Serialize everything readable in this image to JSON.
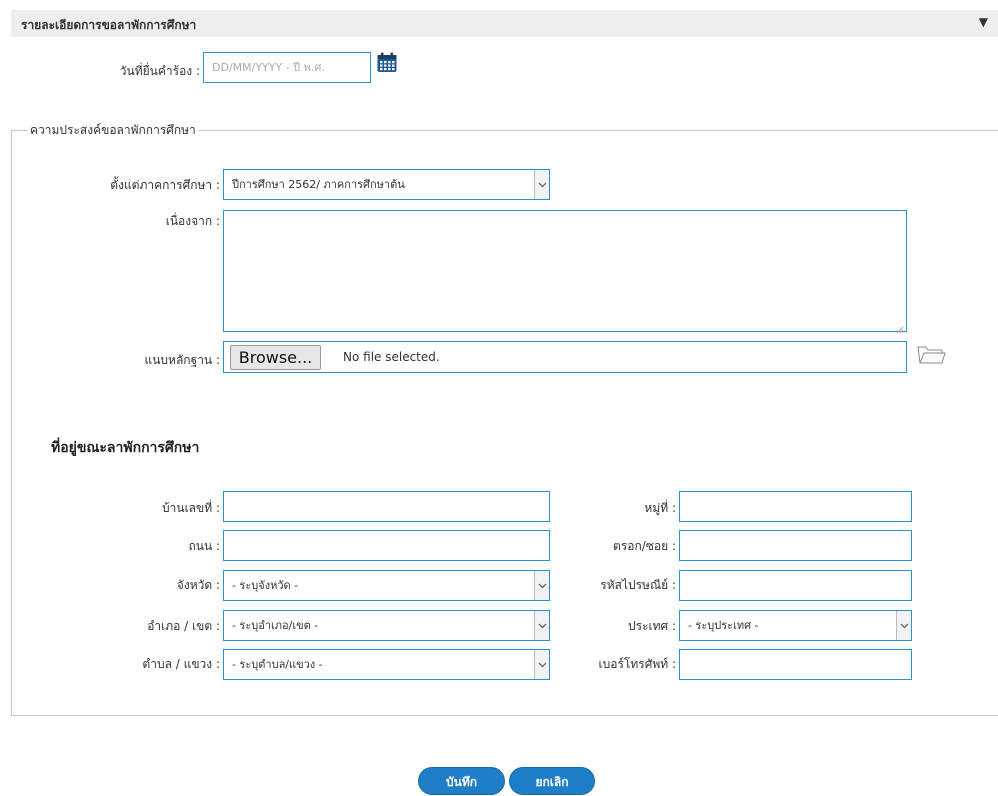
{
  "header": {
    "title": "รายละเอียดการขอลาพักการศึกษา",
    "toggle": "▼"
  },
  "request_date": {
    "label": "วันที่ยื่นคำร้อง :",
    "placeholder": "DD/MM/YYYY - ปี พ.ศ."
  },
  "purpose": {
    "legend": "ความประสงค์ขอลาพักการศึกษา",
    "term_label": "ตั้งแต่ภาคการศึกษา :",
    "term_value": "ปีการศึกษา 2562/ ภาคการศึกษาต้น",
    "reason_label": "เนื่องจาก :",
    "attach_label": "แนบหลักฐาน :",
    "browse_label": "Browse...",
    "file_status": "No file selected."
  },
  "address": {
    "heading": "ที่อยู่ขณะลาพักการศึกษา",
    "house_no_label": "บ้านเลขที่ :",
    "moo_label": "หมู่ที่ :",
    "road_label": "ถนน :",
    "soi_label": "ตรอก/ซอย :",
    "province_label": "จังหวัด :",
    "province_value": "- ระบุจังหวัด -",
    "postcode_label": "รหัสไปรษณีย์ :",
    "district_label": "อำเภอ / เขต :",
    "district_value": "- ระบุอำเภอ/เขต -",
    "country_label": "ประเทศ :",
    "country_value": "- ระบุประเทศ -",
    "subdistrict_label": "ตำบล / แขวง :",
    "subdistrict_value": "- ระบุตำบล/แขวง -",
    "phone_label": "เบอร์โทรศัพท์ :"
  },
  "actions": {
    "save_label": "บันทึก",
    "cancel_label": "ยกเลิก"
  },
  "colors": {
    "accent": "#1f7ec7",
    "border": "#2b8fd1",
    "header_bg": "#eeeeee"
  },
  "icons": {
    "calendar": "calendar-icon",
    "folder": "folder-icon",
    "dropdown": "chevron-down-icon",
    "resize": "resize-grip-icon"
  }
}
